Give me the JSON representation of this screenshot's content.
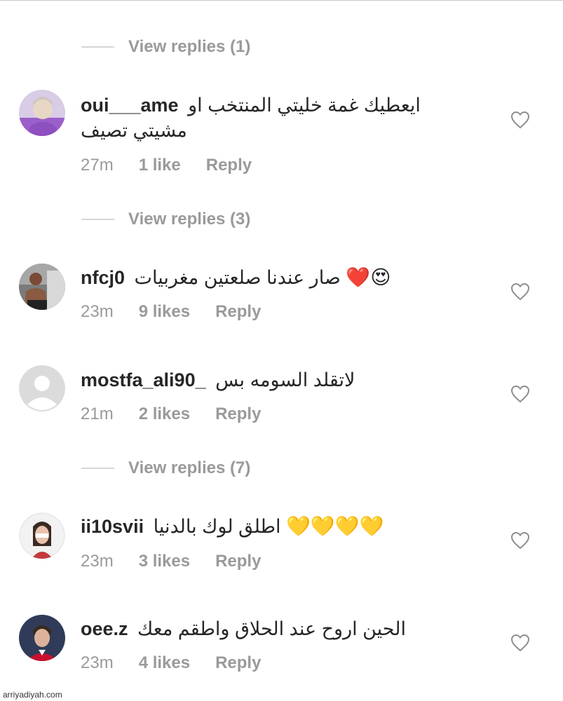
{
  "view_replies": [
    {
      "label": "View replies (1)"
    },
    {
      "label": "View replies (3)"
    },
    {
      "label": "View replies (7)"
    }
  ],
  "comments": [
    {
      "username": "oui___ame",
      "text": "ايعطيك غمة خليتي المنتخب او مشيتي تصيف",
      "time": "27m",
      "likes": "1 like",
      "reply": "Reply"
    },
    {
      "username": "nfcj0",
      "text": "صار عندنا صلعتين مغربيات",
      "emoji": "❤️😍",
      "time": "23m",
      "likes": "9 likes",
      "reply": "Reply"
    },
    {
      "username": "mostfa_ali90_",
      "text": "لاتقلد السومه بس",
      "time": "21m",
      "likes": "2 likes",
      "reply": "Reply"
    },
    {
      "username": "ii10svii",
      "text": "اطلق لوك بالدنيا",
      "emoji": "💛💛💛💛",
      "time": "23m",
      "likes": "3 likes",
      "reply": "Reply"
    },
    {
      "username": "oee.z",
      "text": "الحين اروح عند الحلاق واطقم معك",
      "time": "23m",
      "likes": "4 likes",
      "reply": "Reply"
    }
  ],
  "icons": {
    "like": "heart-outline-icon",
    "avatar_default": "default-avatar-icon"
  },
  "colors": {
    "secondary_text": "#9a9a9a",
    "primary_text": "#262626"
  },
  "watermark": "arriyadiyah.com"
}
